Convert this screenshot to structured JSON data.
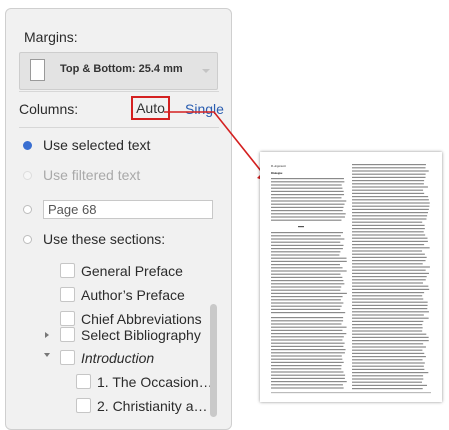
{
  "margins": {
    "label": "Margins:",
    "value": "Top & Bottom:  25.4 mm"
  },
  "columns": {
    "label": "Columns:",
    "auto_label": "Auto",
    "single_label": "Single"
  },
  "options": {
    "selected_text": "Use selected text",
    "filtered_text": "Use filtered text",
    "page_value": "Page 68",
    "these_sections": "Use these sections:"
  },
  "sections": [
    {
      "label": "General Preface"
    },
    {
      "label": "Author’s Preface"
    },
    {
      "label": "Chief Abbreviations"
    },
    {
      "label": "Select Bibliography"
    },
    {
      "label": "Introduction"
    },
    {
      "label": "1. The Occasion…"
    },
    {
      "label": "2. Christianity a…"
    }
  ],
  "preview": {
    "left_header": "B. Argument",
    "left_heading": "Dialogue",
    "colors": {
      "arrow": "#d42020",
      "accent": "#3a6fd1",
      "link": "#2a5db0"
    }
  }
}
